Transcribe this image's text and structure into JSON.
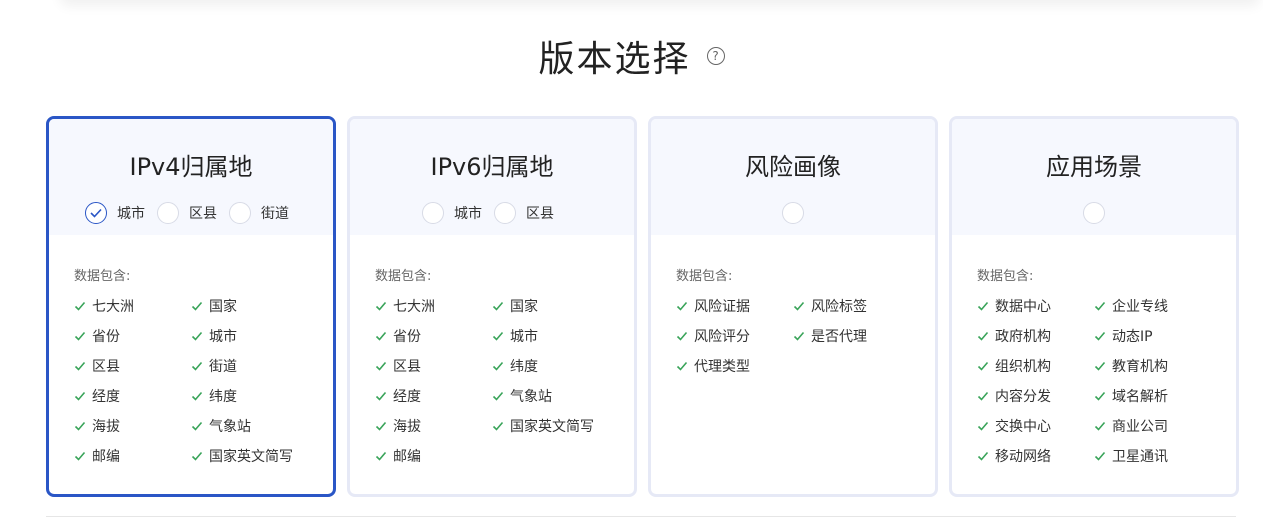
{
  "page": {
    "title": "版本选择",
    "help_icon": "question-circle-icon"
  },
  "colors": {
    "accent": "#2a56c6",
    "check": "#3aa45a",
    "card_border": "#e6e9f6",
    "card_head_bg": "#f6f8fe"
  },
  "cards": [
    {
      "title": "IPv4归属地",
      "selected": true,
      "options": [
        {
          "label": "城市",
          "checked": true
        },
        {
          "label": "区县",
          "checked": false
        },
        {
          "label": "街道",
          "checked": false
        }
      ],
      "includes_label": "数据包含:",
      "features": [
        "七大洲",
        "国家",
        "省份",
        "城市",
        "区县",
        "街道",
        "经度",
        "纬度",
        "海拔",
        "气象站",
        "邮编",
        "国家英文简写"
      ]
    },
    {
      "title": "IPv6归属地",
      "selected": false,
      "options": [
        {
          "label": "城市",
          "checked": false
        },
        {
          "label": "区县",
          "checked": false
        }
      ],
      "includes_label": "数据包含:",
      "features": [
        "七大洲",
        "国家",
        "省份",
        "城市",
        "区县",
        "纬度",
        "经度",
        "气象站",
        "海拔",
        "国家英文简写",
        "邮编"
      ]
    },
    {
      "title": "风险画像",
      "selected": false,
      "options": [
        {
          "label": "",
          "checked": false
        }
      ],
      "includes_label": "数据包含:",
      "features": [
        "风险证据",
        "风险标签",
        "风险评分",
        "是否代理",
        "代理类型"
      ]
    },
    {
      "title": "应用场景",
      "selected": false,
      "options": [
        {
          "label": "",
          "checked": false
        }
      ],
      "includes_label": "数据包含:",
      "features": [
        "数据中心",
        "企业专线",
        "政府机构",
        "动态IP",
        "组织机构",
        "教育机构",
        "内容分发",
        "域名解析",
        "交换中心",
        "商业公司",
        "移动网络",
        "卫星通讯"
      ]
    }
  ]
}
